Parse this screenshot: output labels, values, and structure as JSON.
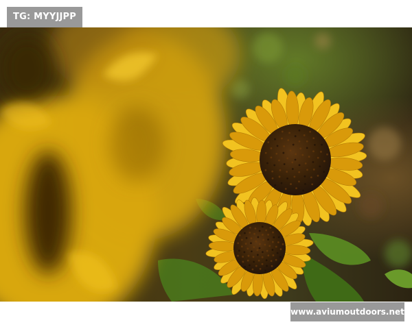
{
  "overlays": {
    "top_tag": "TG: MYYJJPP",
    "bottom_watermark": "www.aviumoutdoors.net"
  },
  "photo": {
    "subject": "sunflowers",
    "colors": {
      "petal": "#f2c320",
      "petal_shadow": "#d99a0a",
      "disk": "#3a2208",
      "disk_highlight": "#6a3a0c",
      "leaf": "#4f7a1c",
      "background_dark": "#2f2a14",
      "blur_yellow": "#e8b70c"
    }
  }
}
